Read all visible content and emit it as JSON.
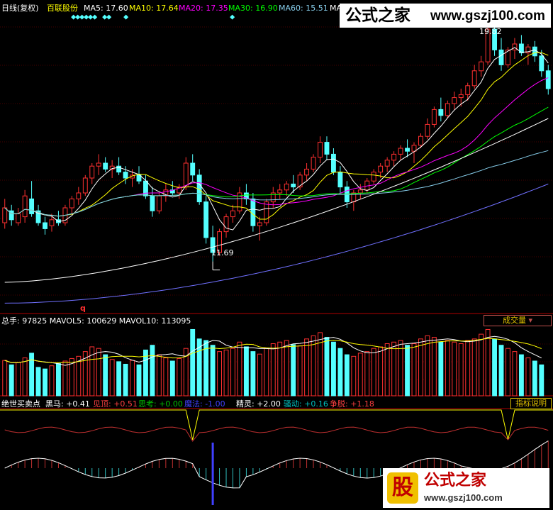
{
  "header": {
    "period": "日线(复权)",
    "stock_name": "百联股份",
    "ma_items": [
      {
        "label": "MA5: 17.60",
        "color": "#ffffff"
      },
      {
        "label": "MA10: 17.64",
        "color": "#ffff00"
      },
      {
        "label": "MA20: 17.35",
        "color": "#ff00ff"
      },
      {
        "label": "MA30: 16.90",
        "color": "#00ff00"
      },
      {
        "label": "MA60: 15.51",
        "color": "#87ceeb"
      },
      {
        "label": "MA",
        "color": "#ffffff"
      }
    ]
  },
  "watermark_top": {
    "text": "公式之家",
    "url": "www.gszj100.com"
  },
  "watermark_bottom": {
    "logo": "股",
    "text": "公式之家",
    "url": "www.gszj100.com"
  },
  "price_panel": {
    "high_label": "19.82",
    "low_label": "11.69",
    "marker": "q"
  },
  "volume_panel": {
    "label": "总手: 97825  MAVOL5: 100629  MAVOL10: 113095",
    "button": "成交量"
  },
  "indicator_panel": {
    "items": [
      {
        "label": "绝世买卖点",
        "color": "#ffffff"
      },
      {
        "label": "黑马: +0.41",
        "color": "#ffffff"
      },
      {
        "label": "见顶: +0.51",
        "color": "#ff4040"
      },
      {
        "label": "思考: +0.00",
        "color": "#00c000"
      },
      {
        "label": "魔法: -1.00",
        "color": "#4040ff"
      },
      {
        "label": "精灵: +2.00",
        "color": "#ffffff"
      },
      {
        "label": "骚动: +0.16",
        "color": "#00c0c0"
      },
      {
        "label": "争脱: +1.18",
        "color": "#ff4040"
      }
    ],
    "button": "指标说明"
  },
  "colors": {
    "up": "#ff3030",
    "down": "#54ffff",
    "grid": "#8b0000",
    "axis": "#b00000"
  },
  "chart_data": {
    "type": "candlestick",
    "candles": [
      [
        13.0,
        13.8,
        12.8,
        13.5
      ],
      [
        13.4,
        13.6,
        12.9,
        13.1
      ],
      [
        13.0,
        13.5,
        12.9,
        13.3
      ],
      [
        13.2,
        14.1,
        13.0,
        13.9
      ],
      [
        13.8,
        14.4,
        13.2,
        13.3
      ],
      [
        13.4,
        13.6,
        12.9,
        13.0
      ],
      [
        13.0,
        13.2,
        12.6,
        12.8
      ],
      [
        12.9,
        13.3,
        12.7,
        13.1
      ],
      [
        13.1,
        13.4,
        12.9,
        13.0
      ],
      [
        13.0,
        13.6,
        12.9,
        13.5
      ],
      [
        13.5,
        13.9,
        13.3,
        13.8
      ],
      [
        13.8,
        14.2,
        13.6,
        14.0
      ],
      [
        14.0,
        14.6,
        13.9,
        14.5
      ],
      [
        14.5,
        15.0,
        14.3,
        14.9
      ],
      [
        14.9,
        15.3,
        14.6,
        15.0
      ],
      [
        15.0,
        15.2,
        14.7,
        14.8
      ],
      [
        14.8,
        15.1,
        14.5,
        14.9
      ],
      [
        14.9,
        15.2,
        14.6,
        14.7
      ],
      [
        14.7,
        14.9,
        14.3,
        14.5
      ],
      [
        14.5,
        14.8,
        14.2,
        14.6
      ],
      [
        14.6,
        14.9,
        14.3,
        14.4
      ],
      [
        14.4,
        14.6,
        13.8,
        13.9
      ],
      [
        13.9,
        14.2,
        13.2,
        13.4
      ],
      [
        13.4,
        14.0,
        13.3,
        13.9
      ],
      [
        13.9,
        14.3,
        13.7,
        14.1
      ],
      [
        14.1,
        14.4,
        13.9,
        14.0
      ],
      [
        14.0,
        14.3,
        13.8,
        14.2
      ],
      [
        14.2,
        15.2,
        14.1,
        15.0
      ],
      [
        15.0,
        15.3,
        14.4,
        14.6
      ],
      [
        14.6,
        14.8,
        13.6,
        13.7
      ],
      [
        13.7,
        13.9,
        12.3,
        12.5
      ],
      [
        12.5,
        12.9,
        11.7,
        12.0
      ],
      [
        12.0,
        12.8,
        11.9,
        12.7
      ],
      [
        12.7,
        13.3,
        12.5,
        13.2
      ],
      [
        13.2,
        13.6,
        13.0,
        13.4
      ],
      [
        13.4,
        14.2,
        13.3,
        14.0
      ],
      [
        14.0,
        14.3,
        13.6,
        13.8
      ],
      [
        13.8,
        14.0,
        12.7,
        12.9
      ],
      [
        12.9,
        13.2,
        12.4,
        13.0
      ],
      [
        13.0,
        13.8,
        12.9,
        13.7
      ],
      [
        13.7,
        14.2,
        13.5,
        14.0
      ],
      [
        14.0,
        14.3,
        13.8,
        14.1
      ],
      [
        14.1,
        14.4,
        13.9,
        14.3
      ],
      [
        14.3,
        14.6,
        14.0,
        14.2
      ],
      [
        14.2,
        14.7,
        14.1,
        14.6
      ],
      [
        14.6,
        15.0,
        14.4,
        14.8
      ],
      [
        14.8,
        15.3,
        14.7,
        15.2
      ],
      [
        15.2,
        15.9,
        15.0,
        15.7
      ],
      [
        15.7,
        15.9,
        15.1,
        15.3
      ],
      [
        15.3,
        15.5,
        14.6,
        14.7
      ],
      [
        14.7,
        14.9,
        14.0,
        14.2
      ],
      [
        14.2,
        14.4,
        13.5,
        13.7
      ],
      [
        13.7,
        14.1,
        13.4,
        14.0
      ],
      [
        14.0,
        14.3,
        13.8,
        14.1
      ],
      [
        14.1,
        14.5,
        14.0,
        14.4
      ],
      [
        14.4,
        14.8,
        14.3,
        14.7
      ],
      [
        14.7,
        15.0,
        14.5,
        14.9
      ],
      [
        14.9,
        15.2,
        14.7,
        15.1
      ],
      [
        15.1,
        15.4,
        14.9,
        15.3
      ],
      [
        15.3,
        15.6,
        15.1,
        15.5
      ],
      [
        15.5,
        15.8,
        15.2,
        15.4
      ],
      [
        15.4,
        15.7,
        15.0,
        15.6
      ],
      [
        15.6,
        16.0,
        15.5,
        15.9
      ],
      [
        15.9,
        16.5,
        15.8,
        16.3
      ],
      [
        16.3,
        16.9,
        16.2,
        16.8
      ],
      [
        16.8,
        17.2,
        16.4,
        16.6
      ],
      [
        16.6,
        17.1,
        16.5,
        17.0
      ],
      [
        17.0,
        17.4,
        16.8,
        17.2
      ],
      [
        17.2,
        17.5,
        16.9,
        17.3
      ],
      [
        17.3,
        17.7,
        17.1,
        17.6
      ],
      [
        17.6,
        18.3,
        17.5,
        18.1
      ],
      [
        18.1,
        18.6,
        17.9,
        18.4
      ],
      [
        18.4,
        19.8,
        18.3,
        19.5
      ],
      [
        19.5,
        19.8,
        18.6,
        18.8
      ],
      [
        18.8,
        19.2,
        18.1,
        18.3
      ],
      [
        18.3,
        18.9,
        18.2,
        18.8
      ],
      [
        18.8,
        19.2,
        18.5,
        19.0
      ],
      [
        19.0,
        19.3,
        18.6,
        18.7
      ],
      [
        18.7,
        19.0,
        18.3,
        18.9
      ],
      [
        18.9,
        19.1,
        18.4,
        18.6
      ],
      [
        18.6,
        18.8,
        17.9,
        18.1
      ],
      [
        18.1,
        18.3,
        17.3,
        17.5
      ]
    ],
    "volume": [
      112,
      98,
      105,
      120,
      135,
      90,
      85,
      95,
      102,
      110,
      118,
      125,
      140,
      155,
      150,
      130,
      115,
      108,
      100,
      112,
      98,
      145,
      160,
      130,
      120,
      110,
      118,
      150,
      210,
      180,
      175,
      160,
      140,
      145,
      150,
      170,
      155,
      140,
      132,
      150,
      165,
      170,
      175,
      162,
      158,
      180,
      190,
      200,
      185,
      170,
      150,
      130,
      125,
      135,
      140,
      150,
      155,
      165,
      170,
      175,
      160,
      165,
      180,
      190,
      185,
      170,
      175,
      170,
      165,
      175,
      180,
      195,
      210,
      180,
      160,
      150,
      140,
      130,
      120,
      110,
      98
    ],
    "indicator": {
      "horse": 0.41,
      "top": 0.51,
      "think": 0.0,
      "magic": -1.0,
      "elf": 2.0,
      "stir": 0.16,
      "struggle": 1.18
    }
  }
}
